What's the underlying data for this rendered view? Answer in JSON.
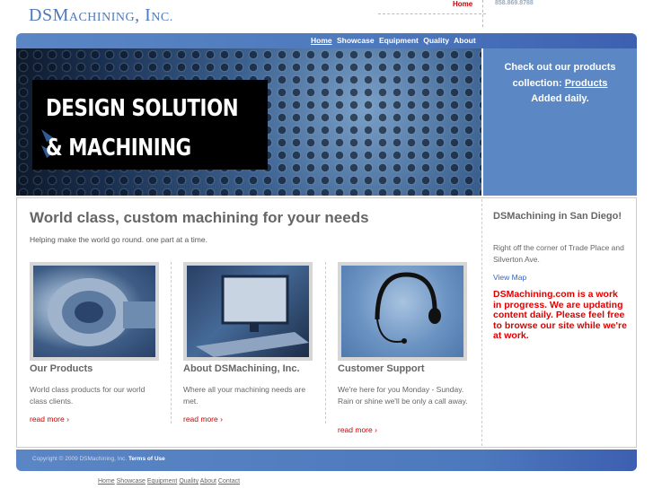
{
  "header": {
    "logo_main": "DSM",
    "logo_small1": "ACHINING",
    "logo_mid": ", I",
    "logo_small2": "NC.",
    "top_link": "Home",
    "phone": "858.869.8788"
  },
  "nav": [
    "Home",
    "Showcase",
    "Equipment",
    "Quality",
    "About"
  ],
  "banner": {
    "line1": "DESIGN SOLUTION",
    "line2": "& MACHINING"
  },
  "promo": {
    "line1": "Check out our products",
    "line2_prefix": "collection: ",
    "link": "Products",
    "line3": "Added daily."
  },
  "main": {
    "headline": "World class, custom machining for your needs",
    "tagline": "Helping make the world go round.  one part at a time.",
    "cards": [
      {
        "title": "Our Products",
        "desc": "World class products for our world class clients.",
        "more": "read more"
      },
      {
        "title": "About DSMachining, Inc.",
        "desc": "Where all your machining needs are met.",
        "more": "read more"
      },
      {
        "title": "Customer Support",
        "desc": "We're here for you Monday - Sunday.  Rain or shine we'll be only a call away.",
        "more": "read more"
      }
    ]
  },
  "sidebar": {
    "title": "DSMachining in San Diego!",
    "desc": "Right off the corner of Trade Place and Silverton Ave.",
    "map_link": "View Map",
    "note": "DSMachining.com is a work in progress. We are updating content daily. Please feel free to browse our site while we're at work."
  },
  "footer": {
    "copyright": "Copyright © 2009 DSMachining, Inc.",
    "terms": "Terms of Use",
    "links": [
      "Home",
      "Showcase",
      "Equipment",
      "Quality",
      "About",
      "Contact"
    ]
  },
  "colors": {
    "accent": "#4c78bd",
    "link_red": "#cc0000"
  }
}
